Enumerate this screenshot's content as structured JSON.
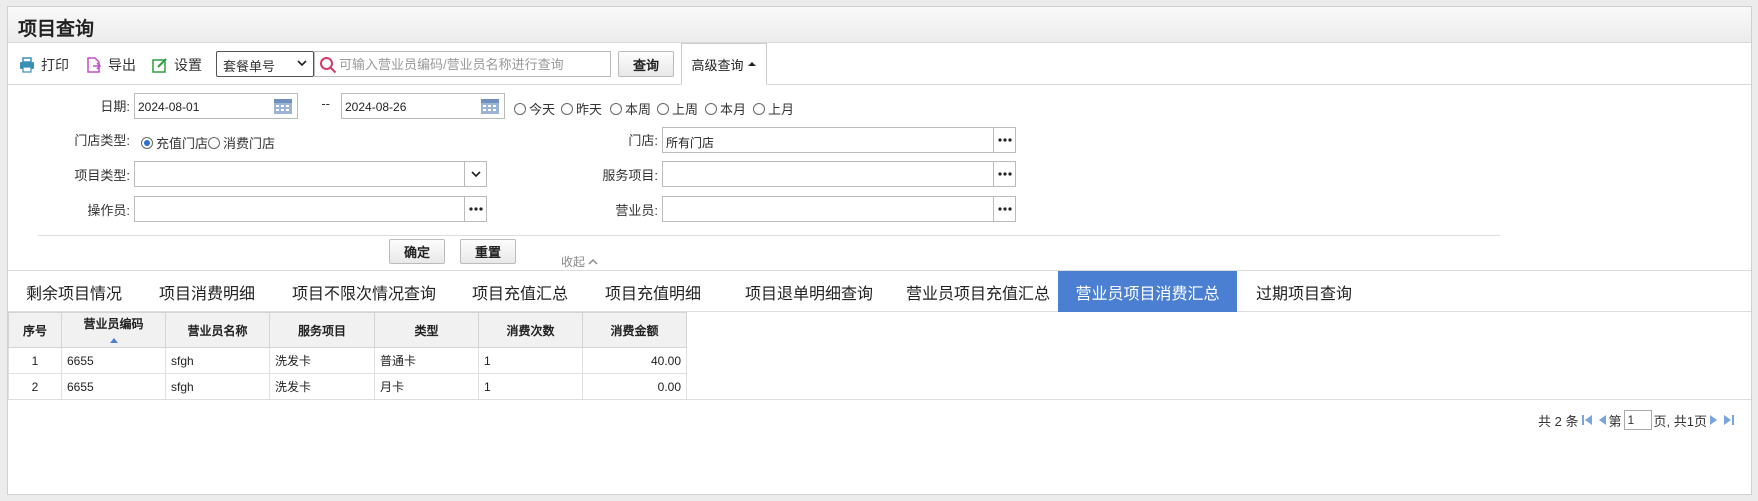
{
  "title": "项目查询",
  "toolbar": {
    "print": "打印",
    "export": "导出",
    "settings": "设置",
    "select_value": "套餐单号",
    "search_placeholder": "可输入营业员编码/营业员名称进行查询",
    "query": "查询",
    "advanced": "高级查询"
  },
  "filters": {
    "date_label": "日期:",
    "date_from": "2024-08-01",
    "date_sep": "--",
    "date_to": "2024-08-26",
    "quick_dates": [
      "今天",
      "昨天",
      "本周",
      "上周",
      "本月",
      "上月"
    ],
    "store_type_label": "门店类型:",
    "store_type_options": [
      "充值门店",
      "消费门店"
    ],
    "store_label": "门店:",
    "store_value": "所有门店",
    "item_type_label": "项目类型:",
    "item_type_value": "",
    "service_label": "服务项目:",
    "service_value": "",
    "operator_label": "操作员:",
    "operator_value": "",
    "salesperson_label": "营业员:",
    "salesperson_value": "",
    "confirm": "确定",
    "reset": "重置",
    "collapse": "收起"
  },
  "tabs": [
    "剩余项目情况",
    "项目消费明细",
    "项目不限次情况查询",
    "项目充值汇总",
    "项目充值明细",
    "项目退单明细查询",
    "营业员项目充值汇总",
    "营业员项目消费汇总",
    "过期项目查询"
  ],
  "active_tab": 7,
  "table": {
    "headers": [
      "序号",
      "营业员编码",
      "营业员名称",
      "服务项目",
      "类型",
      "消费次数",
      "消费金额"
    ],
    "rows": [
      [
        "1",
        "6655",
        "sfgh",
        "洗发卡",
        "普通卡",
        "1",
        "40.00"
      ],
      [
        "2",
        "6655",
        "sfgh",
        "洗发卡",
        "月卡",
        "1",
        "0.00"
      ]
    ]
  },
  "pager": {
    "total": "共 2 条",
    "page_prefix": "第",
    "page": "1",
    "page_suffix": "页, 共1页"
  },
  "colors": {
    "accent": "#4a7fd2",
    "print_icon": "#3a8fb7",
    "export_icon": "#c44fc4",
    "settings_icon": "#2e9e3e",
    "search_icon": "#d33a6a"
  }
}
